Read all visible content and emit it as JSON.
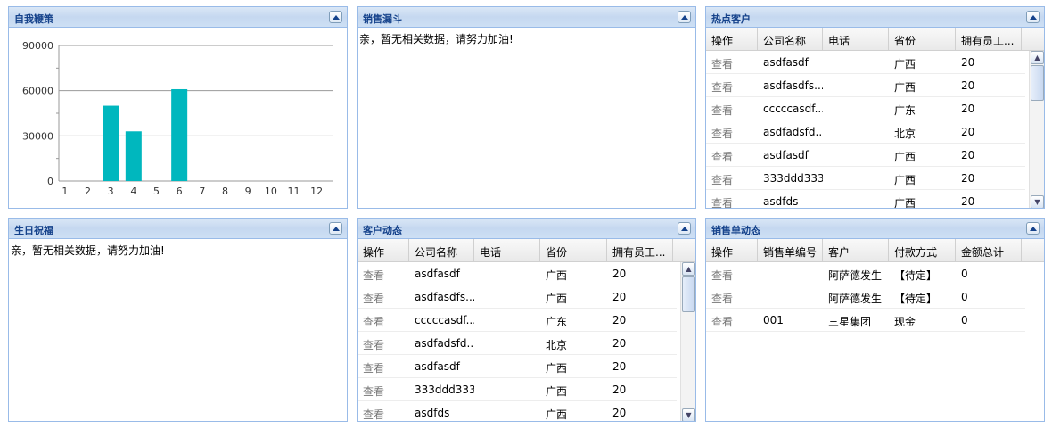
{
  "panels": {
    "p1": {
      "title": "自我鞭策"
    },
    "p2": {
      "title": "销售漏斗",
      "empty": "亲，暂无相关数据，请努力加油!"
    },
    "p3": {
      "title": "热点客户"
    },
    "p4": {
      "title": "生日祝福",
      "empty": "亲，暂无相关数据，请努力加油!"
    },
    "p5": {
      "title": "客户动态"
    },
    "p6": {
      "title": "销售单动态"
    }
  },
  "customers": {
    "columns": [
      "操作",
      "公司名称",
      "电话",
      "省份",
      "拥有员工..."
    ],
    "rows": [
      [
        "查看",
        "asdfasdf",
        "",
        "广西",
        "20"
      ],
      [
        "查看",
        "asdfasdfs...",
        "",
        "广西",
        "20"
      ],
      [
        "查看",
        "cccccasdf...",
        "",
        "广东",
        "20"
      ],
      [
        "查看",
        "asdfadsfd...",
        "",
        "北京",
        "20"
      ],
      [
        "查看",
        "asdfasdf",
        "",
        "广西",
        "20"
      ],
      [
        "查看",
        "333ddd333",
        "",
        "广西",
        "20"
      ],
      [
        "查看",
        "asdfds",
        "",
        "广西",
        "20"
      ]
    ]
  },
  "orders": {
    "columns": [
      "操作",
      "销售单编号",
      "客户",
      "付款方式",
      "金额总计"
    ],
    "rows": [
      [
        "查看",
        "",
        "阿萨德发生",
        "【待定】",
        "0"
      ],
      [
        "查看",
        "",
        "阿萨德发生",
        "【待定】",
        "0"
      ],
      [
        "查看",
        "001",
        "三星集团",
        "现金",
        "0"
      ]
    ]
  },
  "chart_data": {
    "type": "bar",
    "title": "",
    "categories": [
      "1",
      "2",
      "3",
      "4",
      "5",
      "6",
      "7",
      "8",
      "9",
      "10",
      "11",
      "12"
    ],
    "values": [
      0,
      0,
      50000,
      33000,
      0,
      61000,
      0,
      0,
      0,
      0,
      0,
      0
    ],
    "yticks": [
      "0",
      "30000",
      "60000",
      "90000"
    ],
    "ylim": [
      0,
      90000
    ],
    "color": "#00b7be"
  }
}
